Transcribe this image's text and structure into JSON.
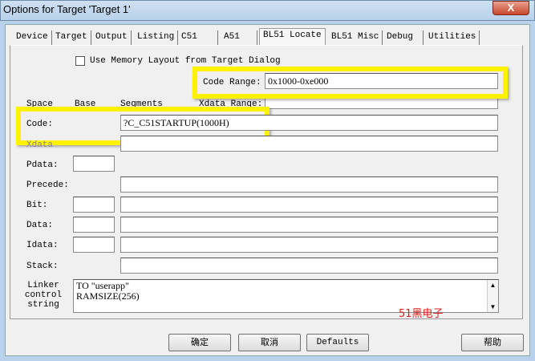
{
  "window": {
    "title": "Options for Target 'Target 1'",
    "close_label": "X"
  },
  "tabs": [
    "Device",
    "Target",
    "Output",
    "Listing",
    "C51",
    "A51",
    "BL51 Locate",
    "BL51 Misc",
    "Debug",
    "Utilities"
  ],
  "active_tab": "BL51 Locate",
  "use_memory_layout": {
    "label": "Use Memory Layout from Target Dialog",
    "checked": false
  },
  "code_range": {
    "label": "Code Range:",
    "value": "0x1000-0xe000"
  },
  "headers": {
    "space": "Space",
    "base": "Base",
    "segments": "Segments",
    "xdata_range": "Xdata Range:"
  },
  "rows": {
    "code": {
      "label": "Code:",
      "segments": "?C_C51STARTUP(1000H)"
    },
    "xdata": {
      "label": "Xdata"
    },
    "pdata": {
      "label": "Pdata:"
    },
    "precede": {
      "label": "Precede:"
    },
    "bit": {
      "label": "Bit:"
    },
    "data": {
      "label": "Data:"
    },
    "idata": {
      "label": "Idata:"
    },
    "stack": {
      "label": "Stack:"
    }
  },
  "linker": {
    "label": "Linker control string",
    "line1": "TO \"userapp\"",
    "line2": "RAMSIZE(256)"
  },
  "watermark": "51黑电子",
  "buttons": {
    "ok": "确定",
    "cancel": "取消",
    "defaults": "Defaults",
    "help": "帮助"
  }
}
